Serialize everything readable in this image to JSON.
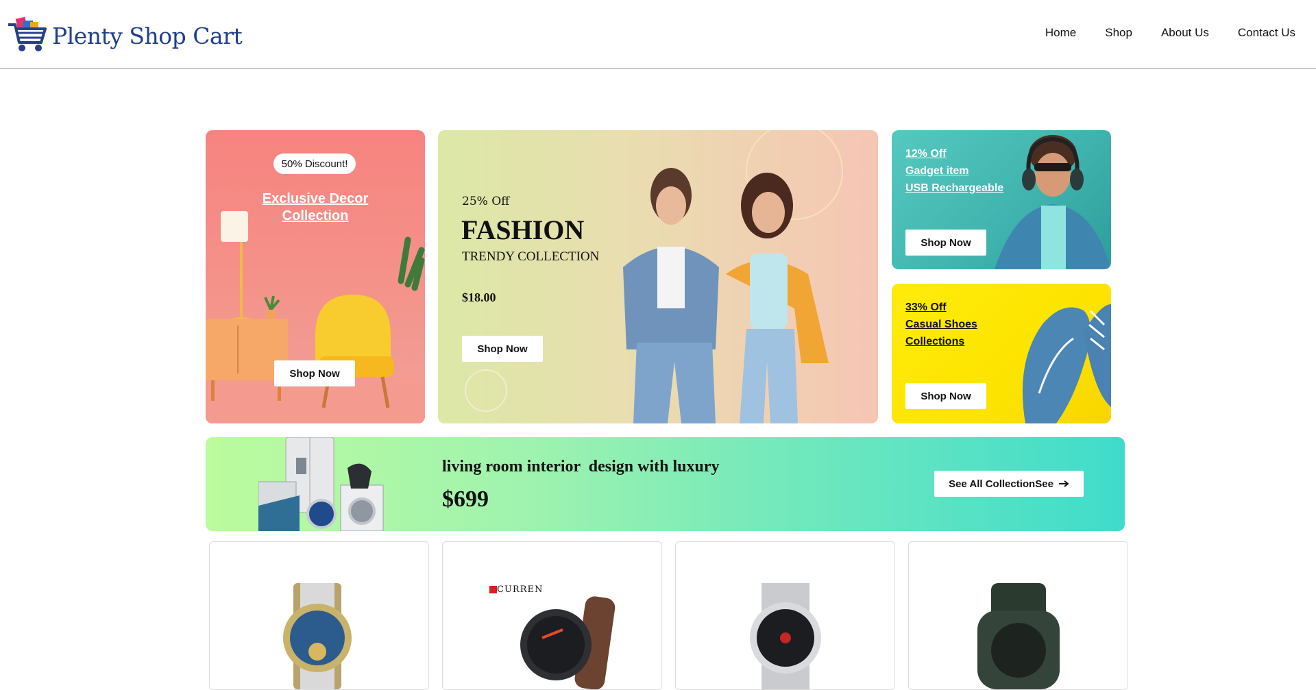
{
  "header": {
    "brand": "Plenty Shop Cart",
    "nav": [
      "Home",
      "Shop",
      "About Us",
      "Contact Us"
    ]
  },
  "promos": {
    "decor": {
      "badge": "50% Discount!",
      "title_line1": "Exclusive Decor",
      "title_line2": "Collection",
      "button": "Shop Now"
    },
    "fashion": {
      "discount": "25% Off",
      "title": "FASHION",
      "subtitle": "TRENDY COLLECTION",
      "price": "$18.00",
      "button": "Shop Now"
    },
    "gadget": {
      "line1": "12% Off",
      "line2": "Gadget item",
      "line3": "USB Rechargeable",
      "button": "Shop Now"
    },
    "shoes": {
      "line1": "33% Off",
      "line2": "Casual Shoes",
      "line3": "Collections",
      "button": "Shop Now"
    }
  },
  "banner": {
    "title": "living room interior  design with luxury",
    "price": "$699",
    "button": "See All CollectionSee",
    "button_icon": "arrow-right-icon"
  },
  "products": {
    "brand_mark": "CURREN",
    "items": [
      "gold-blue-watch",
      "curren-black-watch",
      "silver-mesh-watch",
      "green-digital-watch"
    ]
  },
  "colors": {
    "brand": "#1e3f8a",
    "decor_bg": "#f7837f",
    "gadget_bg": "#3fb2ad",
    "shoes_bg": "#fde400",
    "banner_start": "#bcfb9e",
    "banner_end": "#3fdccb"
  }
}
